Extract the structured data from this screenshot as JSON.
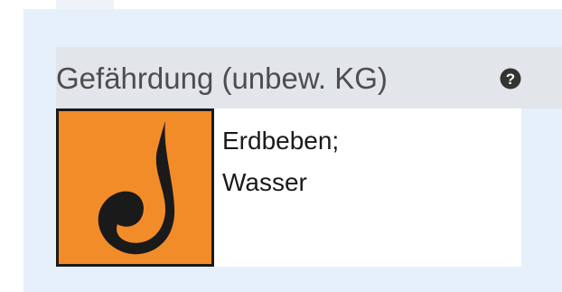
{
  "header": {
    "title": "Gefährdung (unbew. KG)",
    "help_icon": "question-circle-icon"
  },
  "hazard": {
    "icon": "water-drop-hazard-icon",
    "icon_color": "#f28c28",
    "lines": [
      "Erdbeben;",
      "Wasser"
    ]
  },
  "colors": {
    "panel_background": "#e6f0fb",
    "header_background": "#e2e5ea"
  }
}
